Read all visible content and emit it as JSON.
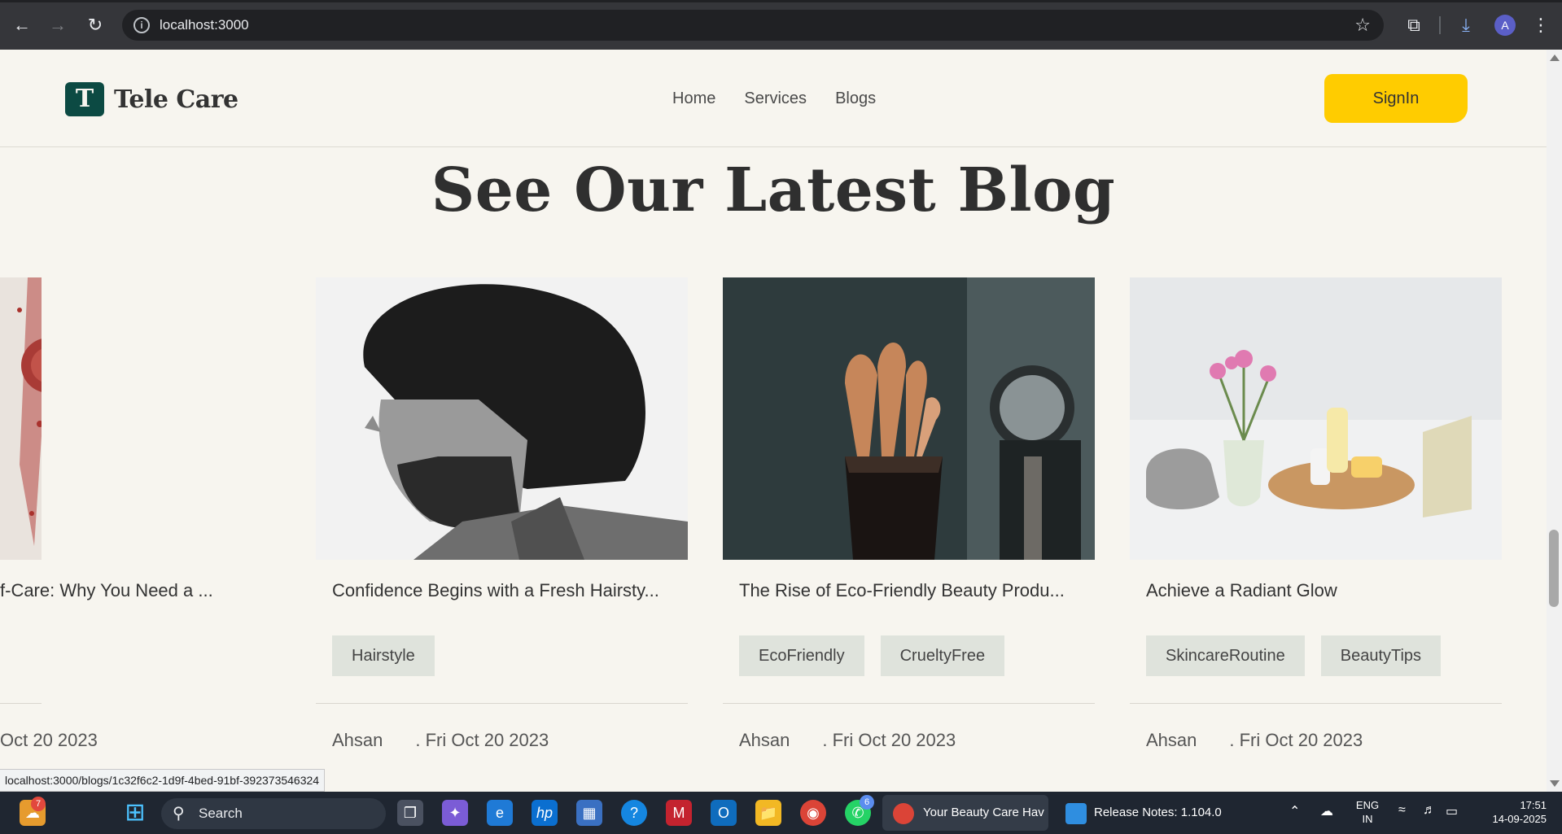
{
  "browser": {
    "url": "localhost:3000",
    "profile_initial": "A"
  },
  "site": {
    "logo_letter": "T",
    "logo_text": "Tele Care",
    "nav": [
      "Home",
      "Services",
      "Blogs"
    ],
    "signin_label": "SignIn"
  },
  "section_title": "See Our Latest Blog",
  "blogs": [
    {
      "title": "f-Care: Why You Need a ...",
      "tags": [],
      "date": "Oct 20 2023",
      "image": "red-powder-blush"
    },
    {
      "title": "Confidence Begins with a Fresh Hairsty...",
      "tags": [
        "Hairstyle"
      ],
      "author": "Ahsan",
      "date": ". Fri Oct 20 2023",
      "image": "bearded-man-portrait"
    },
    {
      "title": "The Rise of Eco-Friendly Beauty Produ...",
      "tags": [
        "EcoFriendly",
        "CrueltyFree"
      ],
      "author": "Ahsan",
      "date": ". Fri Oct 20 2023",
      "image": "makeup-brushes"
    },
    {
      "title": "Achieve a Radiant Glow",
      "tags": [
        "SkincareRoutine",
        "BeautyTips"
      ],
      "author": "Ahsan",
      "date": ". Fri Oct 20 2023",
      "image": "flowers-and-skincare"
    }
  ],
  "status_link": "localhost:3000/blogs/1c32f6c2-1d9f-4bed-91bf-392373546324",
  "taskbar": {
    "search_label": "Search",
    "weather_badge": "7",
    "whatsapp_badge": "6",
    "chrome_window": "Your Beauty Care Hav",
    "vscode_window": "Release Notes: 1.104.0",
    "language": "ENG",
    "region": "IN",
    "time": "17:51",
    "date": "14-09-2025"
  },
  "colors": {
    "accent": "#ffcc00",
    "brand": "#0c4a43",
    "page_bg": "#f7f5ef",
    "tag_bg": "#dfe3dc"
  }
}
